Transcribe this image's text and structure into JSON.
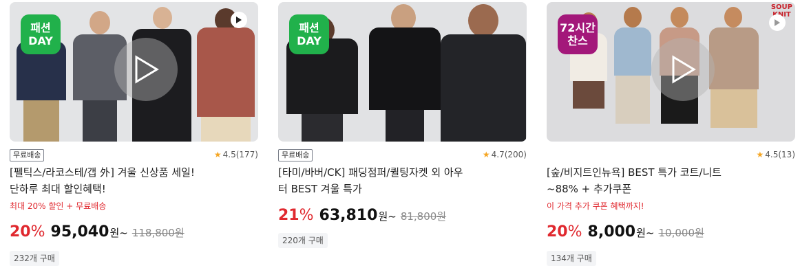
{
  "products": [
    {
      "badge": [
        "패션",
        "DAY"
      ],
      "badge_color": "#21b14b",
      "shipping": "무료배송",
      "rating": "4.5(177)",
      "title_line1": "[펠틱스/라코스테/갭 外] 겨울 신상품 세일!",
      "title_line2": "단하루 최대 할인혜택!",
      "promo": "최대 20% 할인 + 무료배송",
      "discount": "20",
      "discount_unit": "%",
      "price": "95,040",
      "price_unit": "원~",
      "original_price": "118,800원",
      "sold": "232개 구매"
    },
    {
      "badge": [
        "패션",
        "DAY"
      ],
      "badge_color": "#21b14b",
      "shipping": "무료배송",
      "rating": "4.7(200)",
      "title_line1": "[타미/바버/CK] 패딩점퍼/퀼팅자켓 외 아우",
      "title_line2": "터 BEST 겨울 특가",
      "discount": "21",
      "discount_unit": "%",
      "price": "63,810",
      "price_unit": "원~",
      "original_price": "81,800원",
      "sold": "220개 구매"
    },
    {
      "badge": [
        "72시간",
        "찬스"
      ],
      "badge_color": "#a3187a",
      "brand_tag": [
        "SOUP",
        "KNIT"
      ],
      "rating": "4.5(13)",
      "title_line1": "[숲/비지트인뉴욕] BEST 특가 코트/니트",
      "title_line2": "~88% + 추가쿠폰",
      "promo": "이 가격 추가 쿠폰 혜택까지!",
      "discount": "20",
      "discount_unit": "%",
      "price": "8,000",
      "price_unit": "원~",
      "original_price": "10,000원",
      "sold": "134개 구매"
    }
  ],
  "icons": {
    "star": "★",
    "play": "play-icon"
  }
}
